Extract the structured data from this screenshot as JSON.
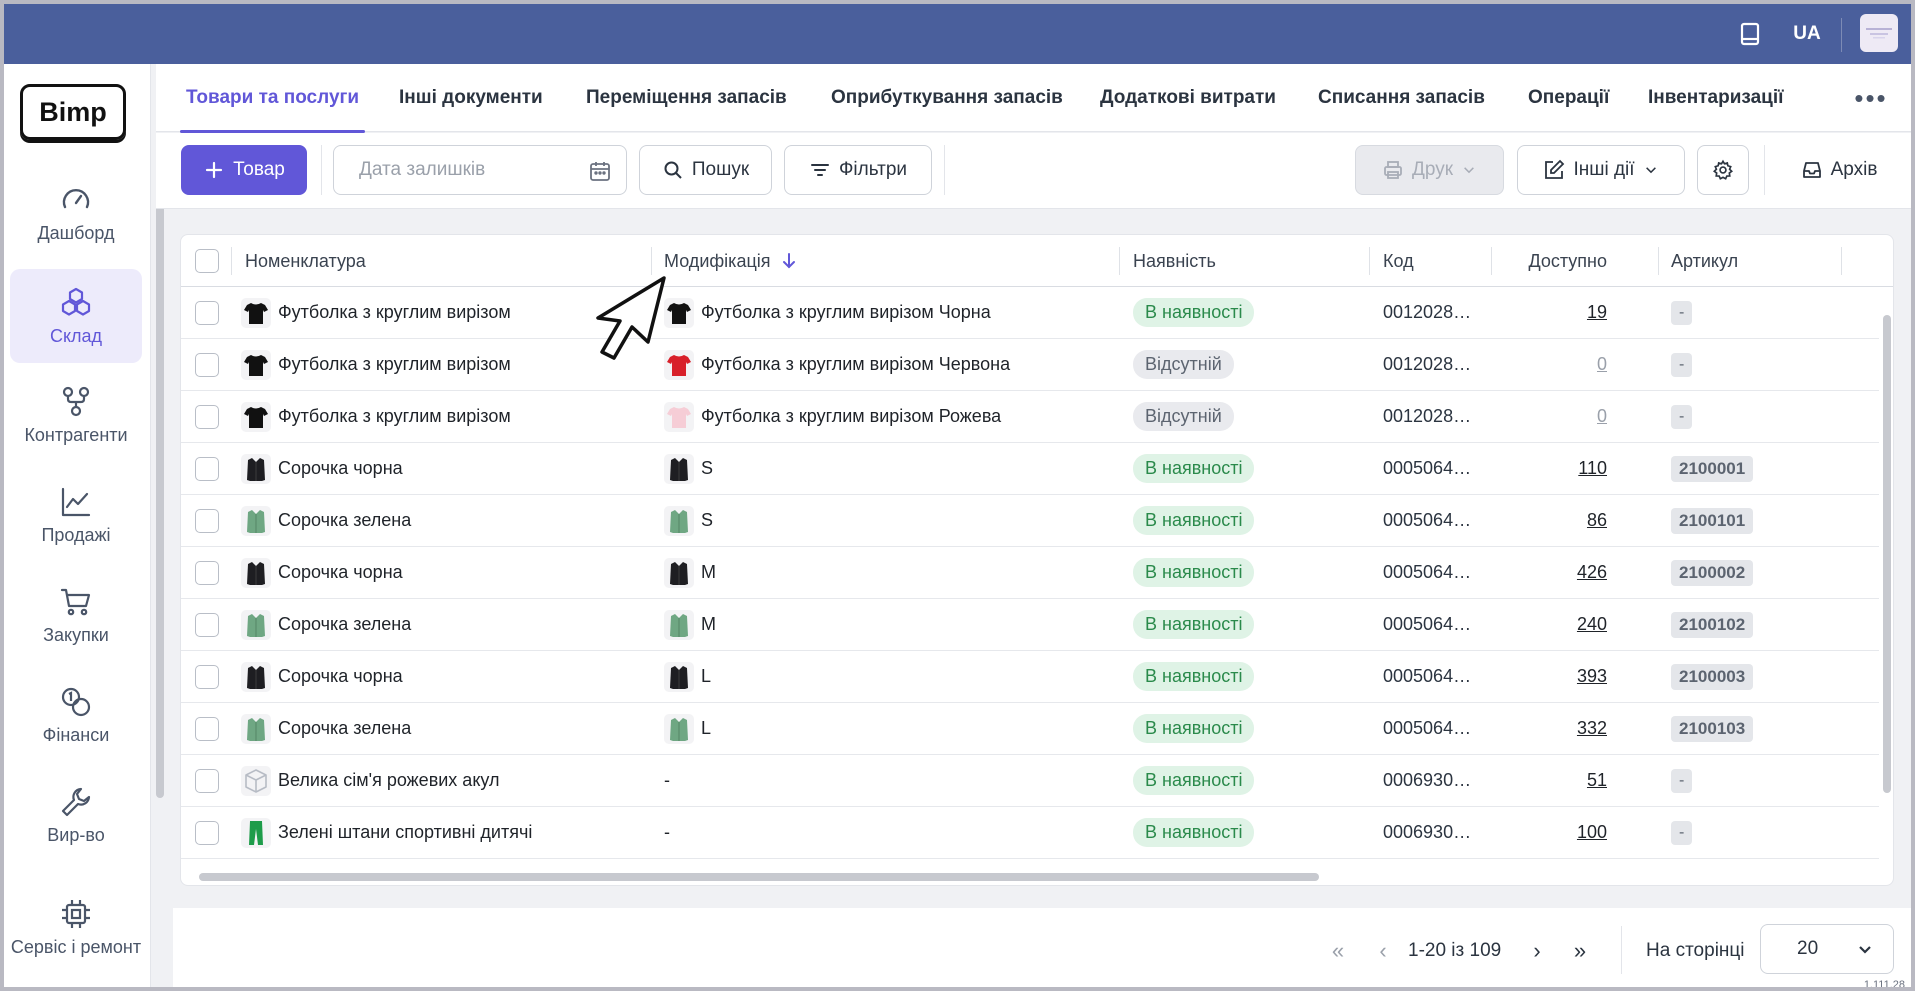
{
  "topbar": {
    "lang": "UA",
    "avatar_text": ""
  },
  "sidebar": {
    "logo": "Bimp",
    "items": [
      {
        "label": "Дашборд",
        "icon": "gauge-icon",
        "active": false
      },
      {
        "label": "Склад",
        "icon": "boxes-icon",
        "active": true
      },
      {
        "label": "Контрагенти",
        "icon": "network-icon",
        "active": false
      },
      {
        "label": "Продажі",
        "icon": "chart-line-icon",
        "active": false
      },
      {
        "label": "Закупки",
        "icon": "cart-icon",
        "active": false
      },
      {
        "label": "Фінанси",
        "icon": "coins-icon",
        "active": false
      },
      {
        "label": "Вир-во",
        "icon": "wrench-icon",
        "active": false
      },
      {
        "label": "Сервіс і ремонт",
        "icon": "chip-icon",
        "active": false
      }
    ]
  },
  "tabs": [
    {
      "label": "Товари та послуги",
      "active": true
    },
    {
      "label": "Інші документи"
    },
    {
      "label": "Переміщення запасів"
    },
    {
      "label": "Оприбуткування запасів"
    },
    {
      "label": "Додаткові витрати"
    },
    {
      "label": "Списання запасів"
    },
    {
      "label": "Операції"
    },
    {
      "label": "Інвентаризації"
    }
  ],
  "toolbar": {
    "add_label": "Товар",
    "date_placeholder": "Дата залишків",
    "search_label": "Пошук",
    "filters_label": "Фільтри",
    "print_label": "Друк",
    "other_actions_label": "Інші дії",
    "archive_label": "Архів"
  },
  "table": {
    "columns": {
      "name": "Номенклатура",
      "modification": "Модифікація",
      "availability": "Наявність",
      "code": "Код",
      "available": "Доступно",
      "article": "Артикул"
    },
    "rows": [
      {
        "name": "Футболка з круглим вирізом",
        "name_thumb": "tshirt-black",
        "mod": "Футболка з круглим вирізом Чорна",
        "mod_thumb": "tshirt-black",
        "status": "В наявності",
        "in_stock": true,
        "code": "0012028…",
        "available": "19",
        "article": "-"
      },
      {
        "name": "Футболка з круглим вирізом",
        "name_thumb": "tshirt-black",
        "mod": "Футболка з круглим вирізом Червона",
        "mod_thumb": "tshirt-red",
        "status": "Відсутній",
        "in_stock": false,
        "code": "0012028…",
        "available": "0",
        "article": "-"
      },
      {
        "name": "Футболка з круглим вирізом",
        "name_thumb": "tshirt-black",
        "mod": "Футболка з круглим вирізом Рожева",
        "mod_thumb": "tshirt-pink",
        "status": "Відсутній",
        "in_stock": false,
        "code": "0012028…",
        "available": "0",
        "article": "-"
      },
      {
        "name": "Сорочка чорна",
        "name_thumb": "shirt-black",
        "mod": "S",
        "mod_thumb": "shirt-black",
        "status": "В наявності",
        "in_stock": true,
        "code": "0005064…",
        "available": "110",
        "article": "2100001"
      },
      {
        "name": "Сорочка зелена",
        "name_thumb": "shirt-green",
        "mod": "S",
        "mod_thumb": "shirt-green",
        "status": "В наявності",
        "in_stock": true,
        "code": "0005064…",
        "available": "86",
        "article": "2100101"
      },
      {
        "name": "Сорочка чорна",
        "name_thumb": "shirt-black",
        "mod": "M",
        "mod_thumb": "shirt-black",
        "status": "В наявності",
        "in_stock": true,
        "code": "0005064…",
        "available": "426",
        "article": "2100002"
      },
      {
        "name": "Сорочка зелена",
        "name_thumb": "shirt-green",
        "mod": "M",
        "mod_thumb": "shirt-green",
        "status": "В наявності",
        "in_stock": true,
        "code": "0005064…",
        "available": "240",
        "article": "2100102"
      },
      {
        "name": "Сорочка чорна",
        "name_thumb": "shirt-black",
        "mod": "L",
        "mod_thumb": "shirt-black",
        "status": "В наявності",
        "in_stock": true,
        "code": "0005064…",
        "available": "393",
        "article": "2100003"
      },
      {
        "name": "Сорочка зелена",
        "name_thumb": "shirt-green",
        "mod": "L",
        "mod_thumb": "shirt-green",
        "status": "В наявності",
        "in_stock": true,
        "code": "0005064…",
        "available": "332",
        "article": "2100103"
      },
      {
        "name": "Велика сім'я рожевих акул",
        "name_thumb": "box",
        "mod": "-",
        "mod_thumb": "",
        "status": "В наявності",
        "in_stock": true,
        "code": "0006930…",
        "available": "51",
        "article": "-"
      },
      {
        "name": "Зелені штани спортивні дитячі",
        "name_thumb": "pants-green",
        "mod": "-",
        "mod_thumb": "",
        "status": "В наявності",
        "in_stock": true,
        "code": "0006930…",
        "available": "100",
        "article": "-"
      }
    ]
  },
  "pagination": {
    "range": "1-20 із 109",
    "per_page_label": "На сторінці",
    "per_page_value": "20"
  },
  "version": "1.111.28",
  "colors": {
    "accent": "#6157d8",
    "topbar": "#4a5f9c",
    "in_stock_bg": "#dff3e6",
    "in_stock_text": "#2a8a4b"
  }
}
